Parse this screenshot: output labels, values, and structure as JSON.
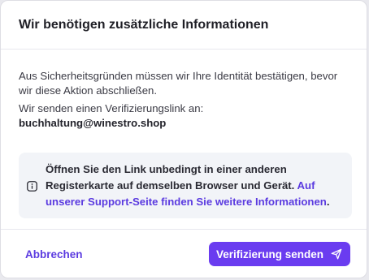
{
  "dialog": {
    "title": "Wir benötigen zusätzliche Informationen",
    "intro": "Aus Sicherheitsgründen müssen wir Ihre Identität bestätigen, bevor wir diese Aktion abschließen.",
    "send_to_label": "Wir senden einen Verifizierungslink an:",
    "email": "buchhaltung@winestro.shop"
  },
  "notice": {
    "icon": "info-icon",
    "text": "Öffnen Sie den Link unbedingt in einer anderen Registerkarte auf demselben Browser und Gerät.",
    "link_text": "Auf unserer Support-Seite finden Sie weitere Informationen",
    "trailing": "."
  },
  "footer": {
    "cancel_label": "Abbrechen",
    "send_label": "Verifizierung senden",
    "send_icon": "paper-plane-icon"
  },
  "colors": {
    "accent": "#6a3cf0",
    "link": "#5b3be0",
    "notice_bg": "#f2f4f8"
  }
}
